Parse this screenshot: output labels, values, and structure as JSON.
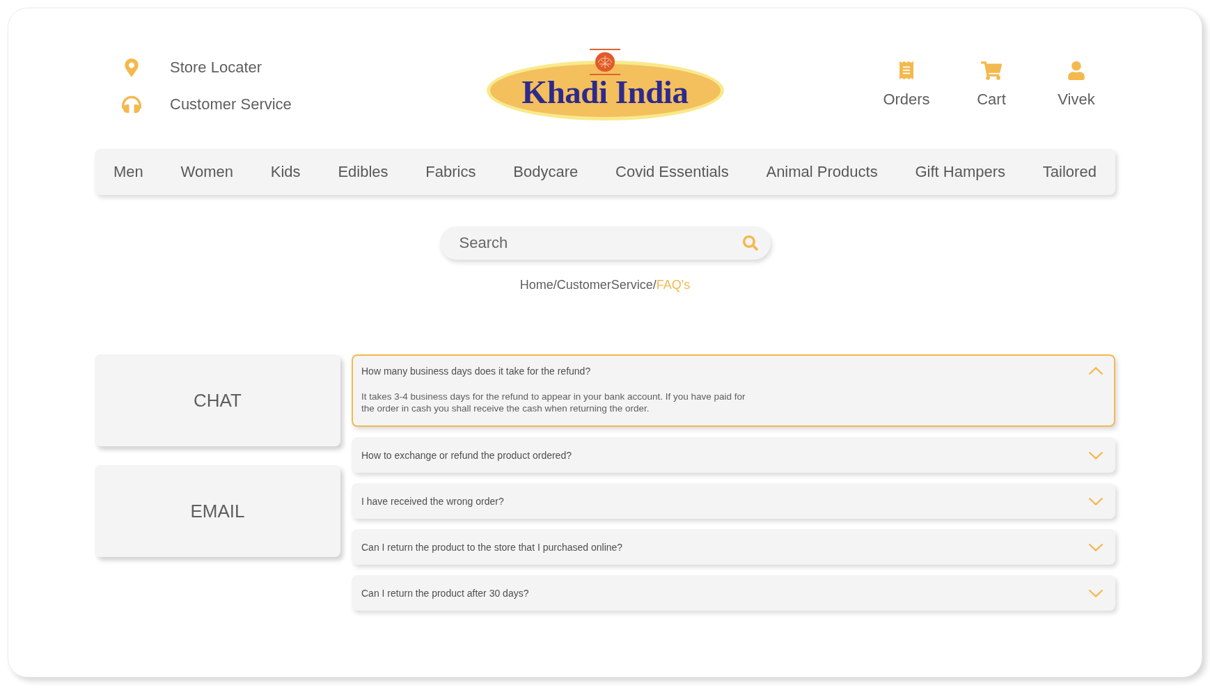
{
  "header": {
    "links": [
      {
        "kind": "location",
        "label": "Store Locater"
      },
      {
        "kind": "support",
        "label": "Customer Service"
      }
    ],
    "logo": {
      "text": "Khadi India"
    },
    "actions": [
      {
        "kind": "orders",
        "label": "Orders"
      },
      {
        "kind": "cart",
        "label": "Cart"
      },
      {
        "kind": "account",
        "label": "Vivek"
      }
    ]
  },
  "nav": {
    "items": [
      "Men",
      "Women",
      "Kids",
      "Edibles",
      "Fabrics",
      "Bodycare",
      "Covid Essentials",
      "Animal Products",
      "Gift Hampers",
      "Tailored"
    ]
  },
  "search": {
    "placeholder": "Search"
  },
  "breadcrumb": {
    "separator": "/",
    "items": [
      {
        "label": "Home",
        "current": false
      },
      {
        "label": "CustomerService",
        "current": false
      },
      {
        "label": "FAQ's",
        "current": true
      }
    ]
  },
  "contact_options": [
    {
      "label": "CHAT"
    },
    {
      "label": "EMAIL"
    }
  ],
  "faqs": [
    {
      "question": "How many business days does it take for the refund?",
      "answer": "It takes 3-4 business days for the refund to appear in your bank account. If you have paid for the order in cash you shall receive the cash when returning the order.",
      "expanded": true
    },
    {
      "question": "How to exchange or refund the product ordered?",
      "expanded": false
    },
    {
      "question": "I have received the wrong order?",
      "expanded": false
    },
    {
      "question": "Can I return the product to the store that I purchased online?",
      "expanded": false
    },
    {
      "question": "Can I return the product after 30 days?",
      "expanded": false
    }
  ]
}
